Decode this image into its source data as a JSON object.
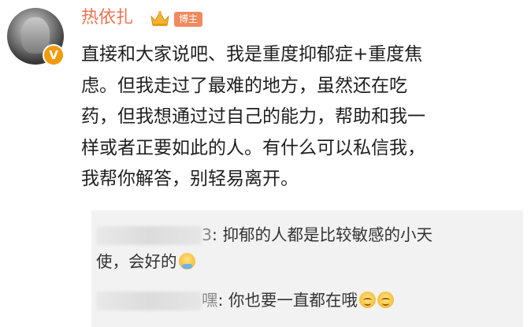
{
  "author": {
    "name": "热依扎",
    "owner_badge": "博主",
    "verified_mark": "V",
    "avatar_icon": "avatar",
    "crown_icon": "crown-icon"
  },
  "post": {
    "lines": [
      "直接和大家说吧、我是重度抑郁症+重度焦",
      "虑。但我走过了最难的地方，虽然还在吃",
      "药，但我想通过过自己的能力，帮助和我一",
      "样或者正要如此的人。有什么可以私信我，",
      "我帮你解答，别轻易离开。"
    ]
  },
  "replies": [
    {
      "name_suffix": "3",
      "text_line1": ": 抑郁的人都是比较敏感的小天",
      "text_line2": "使，会好的",
      "emoji": "bean-emoji"
    },
    {
      "name_suffix": "嘿",
      "text_line1": ": 你也要一直都在哦",
      "emoji": "smile-emoji"
    }
  ],
  "colors": {
    "username": "#eb7350",
    "badge": "#f08a5d",
    "verified": "#f39a0b",
    "reply_bg": "#f2f2f2"
  }
}
